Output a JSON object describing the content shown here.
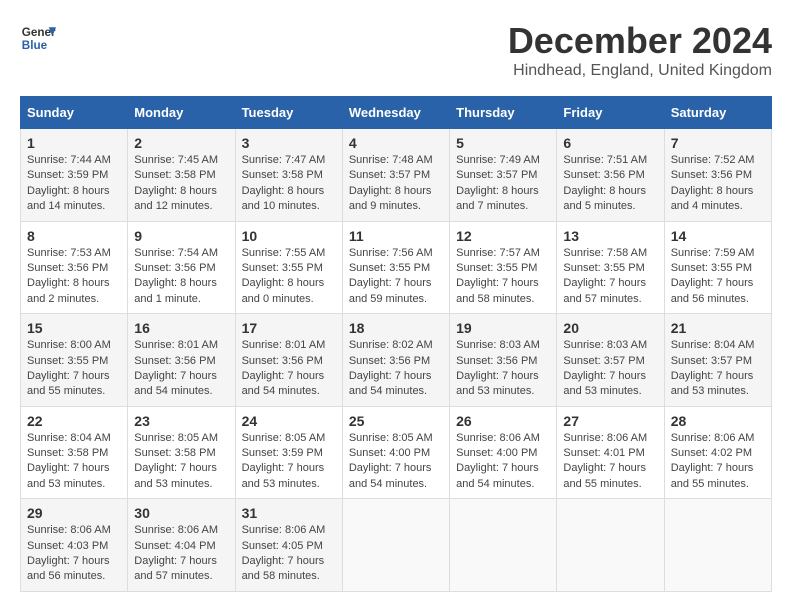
{
  "header": {
    "logo_line1": "General",
    "logo_line2": "Blue",
    "title": "December 2024",
    "subtitle": "Hindhead, England, United Kingdom"
  },
  "days_of_week": [
    "Sunday",
    "Monday",
    "Tuesday",
    "Wednesday",
    "Thursday",
    "Friday",
    "Saturday"
  ],
  "weeks": [
    [
      {
        "day": "1",
        "info": "Sunrise: 7:44 AM\nSunset: 3:59 PM\nDaylight: 8 hours\nand 14 minutes."
      },
      {
        "day": "2",
        "info": "Sunrise: 7:45 AM\nSunset: 3:58 PM\nDaylight: 8 hours\nand 12 minutes."
      },
      {
        "day": "3",
        "info": "Sunrise: 7:47 AM\nSunset: 3:58 PM\nDaylight: 8 hours\nand 10 minutes."
      },
      {
        "day": "4",
        "info": "Sunrise: 7:48 AM\nSunset: 3:57 PM\nDaylight: 8 hours\nand 9 minutes."
      },
      {
        "day": "5",
        "info": "Sunrise: 7:49 AM\nSunset: 3:57 PM\nDaylight: 8 hours\nand 7 minutes."
      },
      {
        "day": "6",
        "info": "Sunrise: 7:51 AM\nSunset: 3:56 PM\nDaylight: 8 hours\nand 5 minutes."
      },
      {
        "day": "7",
        "info": "Sunrise: 7:52 AM\nSunset: 3:56 PM\nDaylight: 8 hours\nand 4 minutes."
      }
    ],
    [
      {
        "day": "8",
        "info": "Sunrise: 7:53 AM\nSunset: 3:56 PM\nDaylight: 8 hours\nand 2 minutes."
      },
      {
        "day": "9",
        "info": "Sunrise: 7:54 AM\nSunset: 3:56 PM\nDaylight: 8 hours\nand 1 minute."
      },
      {
        "day": "10",
        "info": "Sunrise: 7:55 AM\nSunset: 3:55 PM\nDaylight: 8 hours\nand 0 minutes."
      },
      {
        "day": "11",
        "info": "Sunrise: 7:56 AM\nSunset: 3:55 PM\nDaylight: 7 hours\nand 59 minutes."
      },
      {
        "day": "12",
        "info": "Sunrise: 7:57 AM\nSunset: 3:55 PM\nDaylight: 7 hours\nand 58 minutes."
      },
      {
        "day": "13",
        "info": "Sunrise: 7:58 AM\nSunset: 3:55 PM\nDaylight: 7 hours\nand 57 minutes."
      },
      {
        "day": "14",
        "info": "Sunrise: 7:59 AM\nSunset: 3:55 PM\nDaylight: 7 hours\nand 56 minutes."
      }
    ],
    [
      {
        "day": "15",
        "info": "Sunrise: 8:00 AM\nSunset: 3:55 PM\nDaylight: 7 hours\nand 55 minutes."
      },
      {
        "day": "16",
        "info": "Sunrise: 8:01 AM\nSunset: 3:56 PM\nDaylight: 7 hours\nand 54 minutes."
      },
      {
        "day": "17",
        "info": "Sunrise: 8:01 AM\nSunset: 3:56 PM\nDaylight: 7 hours\nand 54 minutes."
      },
      {
        "day": "18",
        "info": "Sunrise: 8:02 AM\nSunset: 3:56 PM\nDaylight: 7 hours\nand 54 minutes."
      },
      {
        "day": "19",
        "info": "Sunrise: 8:03 AM\nSunset: 3:56 PM\nDaylight: 7 hours\nand 53 minutes."
      },
      {
        "day": "20",
        "info": "Sunrise: 8:03 AM\nSunset: 3:57 PM\nDaylight: 7 hours\nand 53 minutes."
      },
      {
        "day": "21",
        "info": "Sunrise: 8:04 AM\nSunset: 3:57 PM\nDaylight: 7 hours\nand 53 minutes."
      }
    ],
    [
      {
        "day": "22",
        "info": "Sunrise: 8:04 AM\nSunset: 3:58 PM\nDaylight: 7 hours\nand 53 minutes."
      },
      {
        "day": "23",
        "info": "Sunrise: 8:05 AM\nSunset: 3:58 PM\nDaylight: 7 hours\nand 53 minutes."
      },
      {
        "day": "24",
        "info": "Sunrise: 8:05 AM\nSunset: 3:59 PM\nDaylight: 7 hours\nand 53 minutes."
      },
      {
        "day": "25",
        "info": "Sunrise: 8:05 AM\nSunset: 4:00 PM\nDaylight: 7 hours\nand 54 minutes."
      },
      {
        "day": "26",
        "info": "Sunrise: 8:06 AM\nSunset: 4:00 PM\nDaylight: 7 hours\nand 54 minutes."
      },
      {
        "day": "27",
        "info": "Sunrise: 8:06 AM\nSunset: 4:01 PM\nDaylight: 7 hours\nand 55 minutes."
      },
      {
        "day": "28",
        "info": "Sunrise: 8:06 AM\nSunset: 4:02 PM\nDaylight: 7 hours\nand 55 minutes."
      }
    ],
    [
      {
        "day": "29",
        "info": "Sunrise: 8:06 AM\nSunset: 4:03 PM\nDaylight: 7 hours\nand 56 minutes."
      },
      {
        "day": "30",
        "info": "Sunrise: 8:06 AM\nSunset: 4:04 PM\nDaylight: 7 hours\nand 57 minutes."
      },
      {
        "day": "31",
        "info": "Sunrise: 8:06 AM\nSunset: 4:05 PM\nDaylight: 7 hours\nand 58 minutes."
      },
      {
        "day": "",
        "info": ""
      },
      {
        "day": "",
        "info": ""
      },
      {
        "day": "",
        "info": ""
      },
      {
        "day": "",
        "info": ""
      }
    ]
  ]
}
